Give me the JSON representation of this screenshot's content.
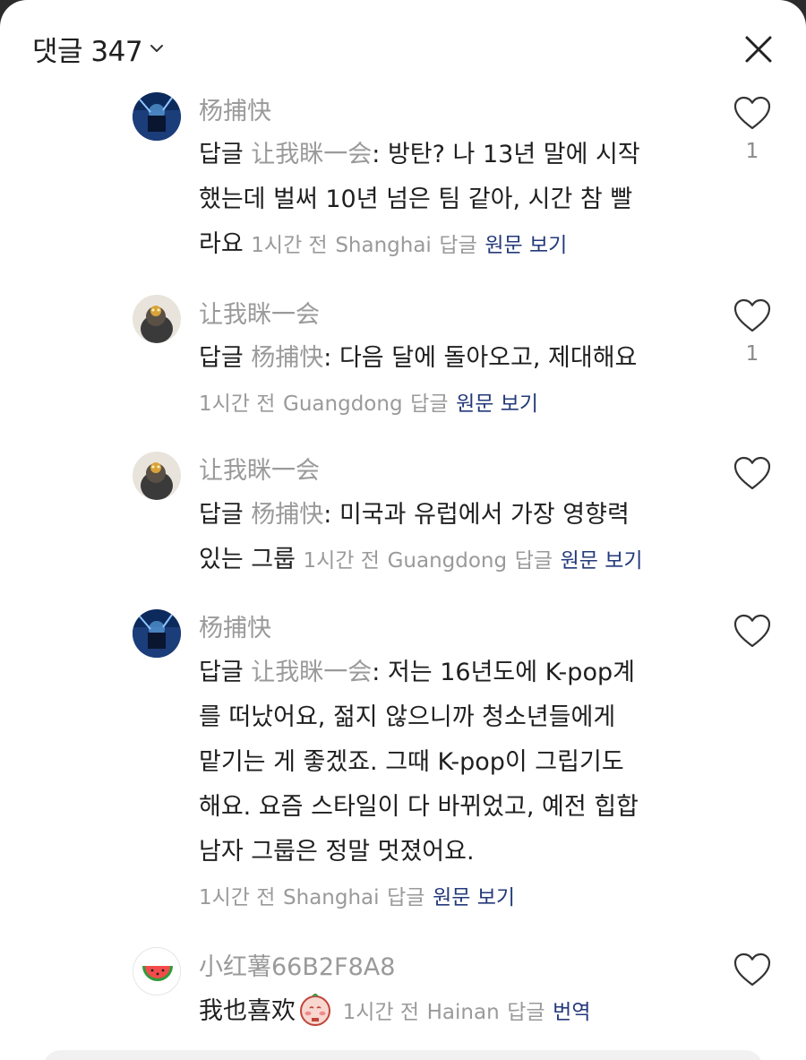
{
  "header": {
    "title": "댓글 347",
    "chevron_icon": "chevron-down-icon",
    "close_icon": "close-icon"
  },
  "comments": [
    {
      "name": "杨捕快",
      "reply_prefix": "답글",
      "reply_to": "让我眯一会",
      "text_lines": [
        "방탄? 나 13년 말에 시작",
        "했는데 벌써 10년 넘은 팀 같아, 시간 참 빨",
        "라요"
      ],
      "time": "1시간 전",
      "location": "Shanghai",
      "reply_label": "답글",
      "view_original": "원문 보기",
      "likes": "1"
    },
    {
      "name": "让我眯一会",
      "reply_prefix": "답글",
      "reply_to": "杨捕快",
      "text_lines": [
        "다음 달에 돌아오고, 제대해요"
      ],
      "time": "1시간 전",
      "location": "Guangdong",
      "reply_label": "답글",
      "view_original": "원문 보기",
      "likes": "1"
    },
    {
      "name": "让我眯一会",
      "reply_prefix": "답글",
      "reply_to": "杨捕快",
      "text_lines": [
        "미국과 유럽에서 가장 영향력",
        "있는 그룹"
      ],
      "time": "1시간 전",
      "location": "Guangdong",
      "reply_label": "답글",
      "view_original": "원문 보기",
      "likes": ""
    },
    {
      "name": "杨捕快",
      "reply_prefix": "답글",
      "reply_to": "让我眯一会",
      "text_lines": [
        "저는 16년도에 K-pop계",
        "를 떠났어요, 젊지 않으니까 청소년들에게",
        "맡기는 게 좋겠죠. 그때 K-pop이 그립기도",
        "해요. 요즘 스타일이 다 바뀌었고, 예전 힙합",
        "남자 그룹은 정말 멋졌어요."
      ],
      "time": "1시간 전",
      "location": "Shanghai",
      "reply_label": "답글",
      "view_original": "원문 보기",
      "likes": ""
    },
    {
      "name": "小红薯66B2F8A8",
      "text": "我也喜欢",
      "emoji_icon": "shy-face-emoji-icon",
      "time": "1시간 전",
      "location": "Hainan",
      "reply_label": "답글",
      "translate": "번역",
      "likes": ""
    }
  ],
  "colors": {
    "link": "#23397a",
    "muted": "#9a9a9a",
    "text": "#1f1f1f"
  }
}
